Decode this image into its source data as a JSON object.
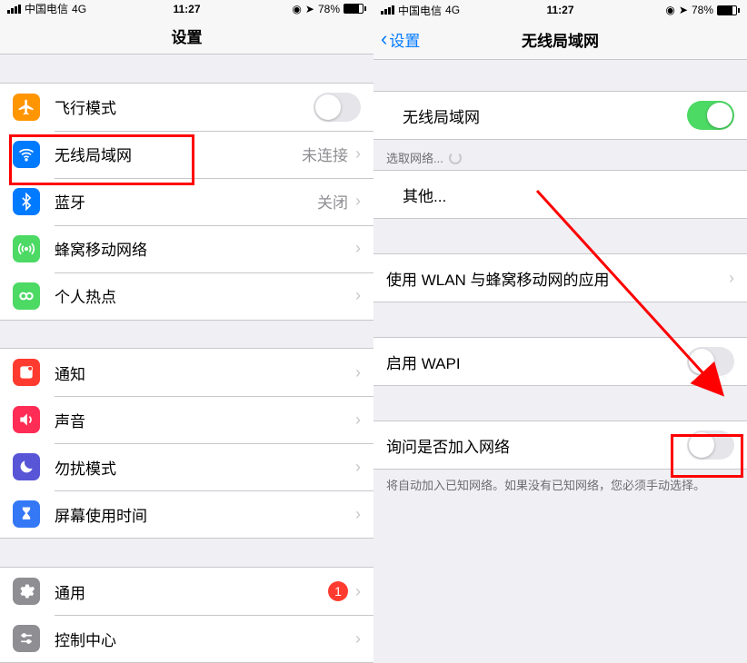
{
  "status": {
    "carrier": "中国电信",
    "network": "4G",
    "time": "11:27",
    "battery_pct": "78%"
  },
  "left": {
    "title": "设置",
    "rows": {
      "airplane": "飞行模式",
      "wifi": "无线局域网",
      "wifi_detail": "未连接",
      "bluetooth": "蓝牙",
      "bluetooth_detail": "关闭",
      "cellular": "蜂窝移动网络",
      "hotspot": "个人热点",
      "notifications": "通知",
      "sound": "声音",
      "dnd": "勿扰模式",
      "screentime": "屏幕使用时间",
      "general": "通用",
      "general_badge": "1",
      "control_center": "控制中心"
    }
  },
  "right": {
    "back": "设置",
    "title": "无线局域网",
    "wifi_toggle_label": "无线局域网",
    "choose_network": "选取网络...",
    "other": "其他...",
    "wlan_apps": "使用 WLAN 与蜂窝移动网的应用",
    "wapi": "启用 WAPI",
    "ask_join": "询问是否加入网络",
    "footer": "将自动加入已知网络。如果没有已知网络，您必须手动选择。"
  }
}
